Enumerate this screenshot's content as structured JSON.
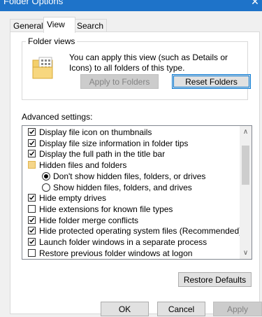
{
  "window": {
    "title": "Folder Options",
    "close_glyph": "✕"
  },
  "tabs": [
    {
      "label": "General"
    },
    {
      "label": "View"
    },
    {
      "label": "Search"
    }
  ],
  "folder_views": {
    "legend": "Folder views",
    "description": "You can apply this view (such as Details or Icons) to all folders of this type.",
    "apply_label": "Apply to Folders",
    "reset_label": "Reset Folders"
  },
  "advanced": {
    "label": "Advanced settings:",
    "items": [
      {
        "type": "checkbox",
        "checked": true,
        "label": "Display file icon on thumbnails"
      },
      {
        "type": "checkbox",
        "checked": true,
        "label": "Display file size information in folder tips"
      },
      {
        "type": "checkbox",
        "checked": true,
        "label": "Display the full path in the title bar"
      },
      {
        "type": "folder",
        "label": "Hidden files and folders"
      },
      {
        "type": "radio",
        "selected": true,
        "label": "Don't show hidden files, folders, or drives"
      },
      {
        "type": "radio",
        "selected": false,
        "label": "Show hidden files, folders, and drives"
      },
      {
        "type": "checkbox",
        "checked": true,
        "label": "Hide empty drives"
      },
      {
        "type": "checkbox",
        "checked": false,
        "label": "Hide extensions for known file types"
      },
      {
        "type": "checkbox",
        "checked": true,
        "label": "Hide folder merge conflicts"
      },
      {
        "type": "checkbox",
        "checked": true,
        "label": "Hide protected operating system files (Recommended)"
      },
      {
        "type": "checkbox",
        "checked": true,
        "label": "Launch folder windows in a separate process"
      },
      {
        "type": "checkbox",
        "checked": false,
        "label": "Restore previous folder windows at logon"
      }
    ],
    "restore_label": "Restore Defaults"
  },
  "footer": {
    "ok_label": "OK",
    "cancel_label": "Cancel",
    "apply_label": "Apply"
  }
}
